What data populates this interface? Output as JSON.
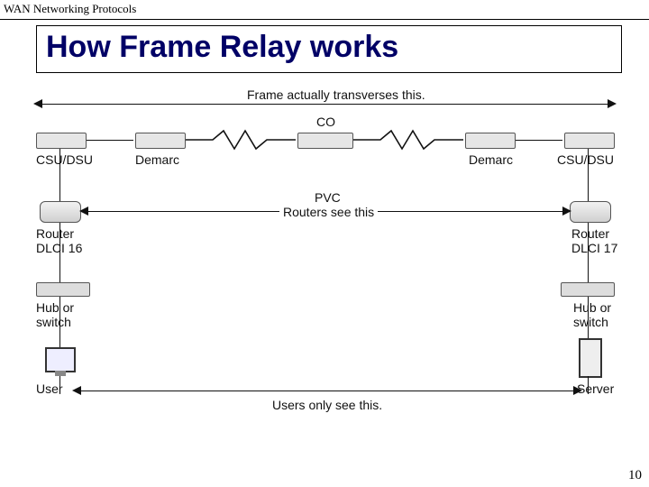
{
  "header": {
    "breadcrumb": "WAN Networking Protocols"
  },
  "title": "How Frame Relay works",
  "diagram": {
    "top_caption": "Frame actually transverses this.",
    "co_label": "CO",
    "left": {
      "csu": "CSU/DSU",
      "demarc": "Demarc",
      "router_line1": "Router",
      "router_line2": "DLCI 16",
      "hub_line1": "Hub or",
      "hub_line2": "switch",
      "endpoint": "User"
    },
    "right": {
      "csu": "CSU/DSU",
      "demarc": "Demarc",
      "router_line1": "Router",
      "router_line2": "DLCI 17",
      "hub_line1": "Hub or",
      "hub_line2": "switch",
      "endpoint": "Server"
    },
    "mid_line1": "PVC",
    "mid_line2": "Routers see this",
    "bottom_caption": "Users only see this."
  },
  "page_number": "10"
}
